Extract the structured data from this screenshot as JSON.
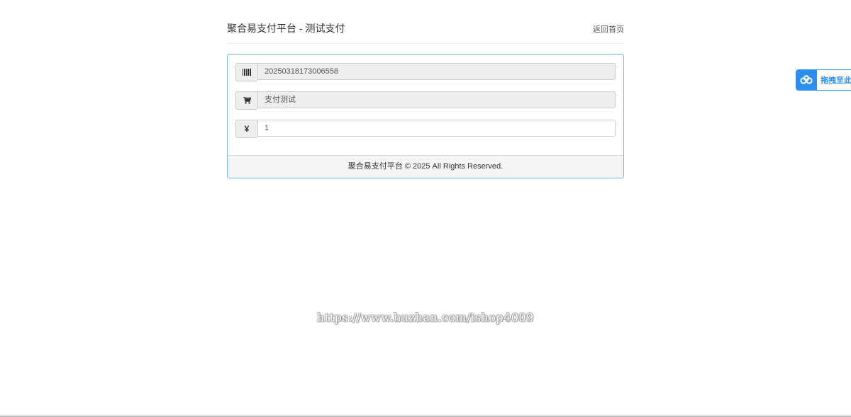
{
  "header": {
    "title": "聚合易支付平台 - 测试支付",
    "home_link": "返回首页"
  },
  "form": {
    "order_no": {
      "icon": "barcode-icon",
      "value": "20250318173006558"
    },
    "product_name": {
      "icon": "cart-icon",
      "value": "支付测试"
    },
    "amount": {
      "icon": "yen-icon",
      "symbol": "¥",
      "value": "1"
    }
  },
  "footer": {
    "copyright": "聚合易支付平台 © 2025 All Rights Reserved."
  },
  "watermark": "https://www.huzhan.com/ishop4009",
  "float_widget": {
    "label": "拖拽至此",
    "icon": "cloud-icon",
    "accent": "#2b8ef0"
  },
  "colors": {
    "panel_border": "#7ab4e6",
    "addon_bg": "#eeeeee"
  }
}
